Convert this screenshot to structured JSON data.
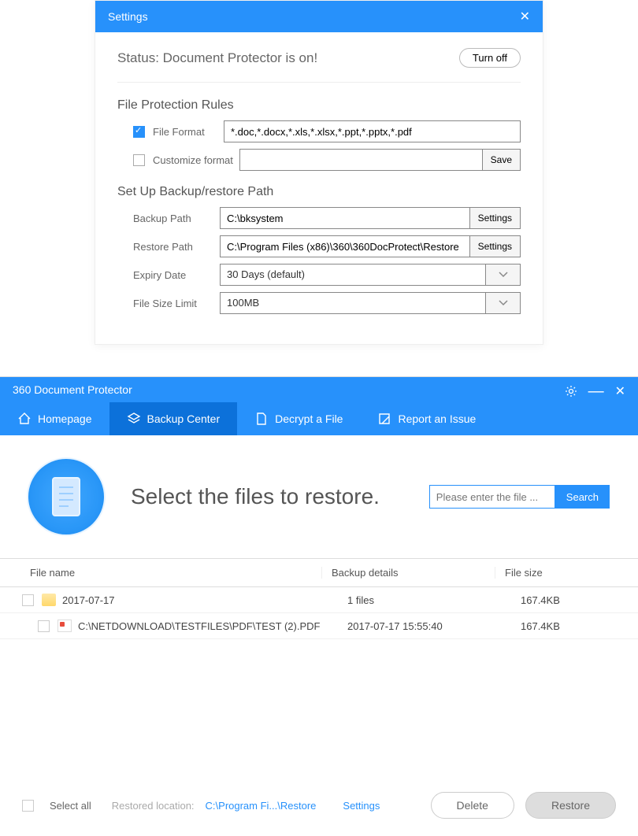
{
  "settings": {
    "title": "Settings",
    "status_text": "Status: Document Protector is on!",
    "turn_off": "Turn off",
    "rules_title": "File Protection Rules",
    "file_format_label": "File Format",
    "file_format_value": "*.doc,*.docx,*.xls,*.xlsx,*.ppt,*.pptx,*.pdf",
    "customize_label": "Customize format",
    "customize_value": "",
    "save": "Save",
    "backup_title": "Set Up Backup/restore Path",
    "backup_path_label": "Backup Path",
    "backup_path_value": "C:\\bksystem",
    "restore_path_label": "Restore Path",
    "restore_path_value": "C:\\Program Files (x86)\\360\\360DocProtect\\Restore",
    "settings_btn": "Settings",
    "expiry_label": "Expiry Date",
    "expiry_value": "30 Days (default)",
    "size_limit_label": "File Size Limit",
    "size_limit_value": "100MB"
  },
  "main": {
    "app_title": "360 Document Protector",
    "tabs": {
      "homepage": "Homepage",
      "backup": "Backup Center",
      "decrypt": "Decrypt a File",
      "report": "Report an Issue"
    },
    "hero_title": "Select the files to restore.",
    "search_placeholder": "Please enter the file ...",
    "search_btn": "Search",
    "columns": {
      "name": "File name",
      "details": "Backup details",
      "size": "File size"
    },
    "rows": [
      {
        "name": "2017-07-17",
        "details": "1 files",
        "size": "167.4KB",
        "type": "folder"
      },
      {
        "name": "C:\\NETDOWNLOAD\\TESTFILES\\PDF\\TEST (2).PDF",
        "details": "2017-07-17 15:55:40",
        "size": "167.4KB",
        "type": "file"
      }
    ],
    "footer": {
      "select_all": "Select all",
      "restored_loc_label": "Restored location:",
      "restored_loc_value": "C:\\Program Fi...\\Restore",
      "settings_link": "Settings",
      "delete": "Delete",
      "restore": "Restore"
    }
  }
}
